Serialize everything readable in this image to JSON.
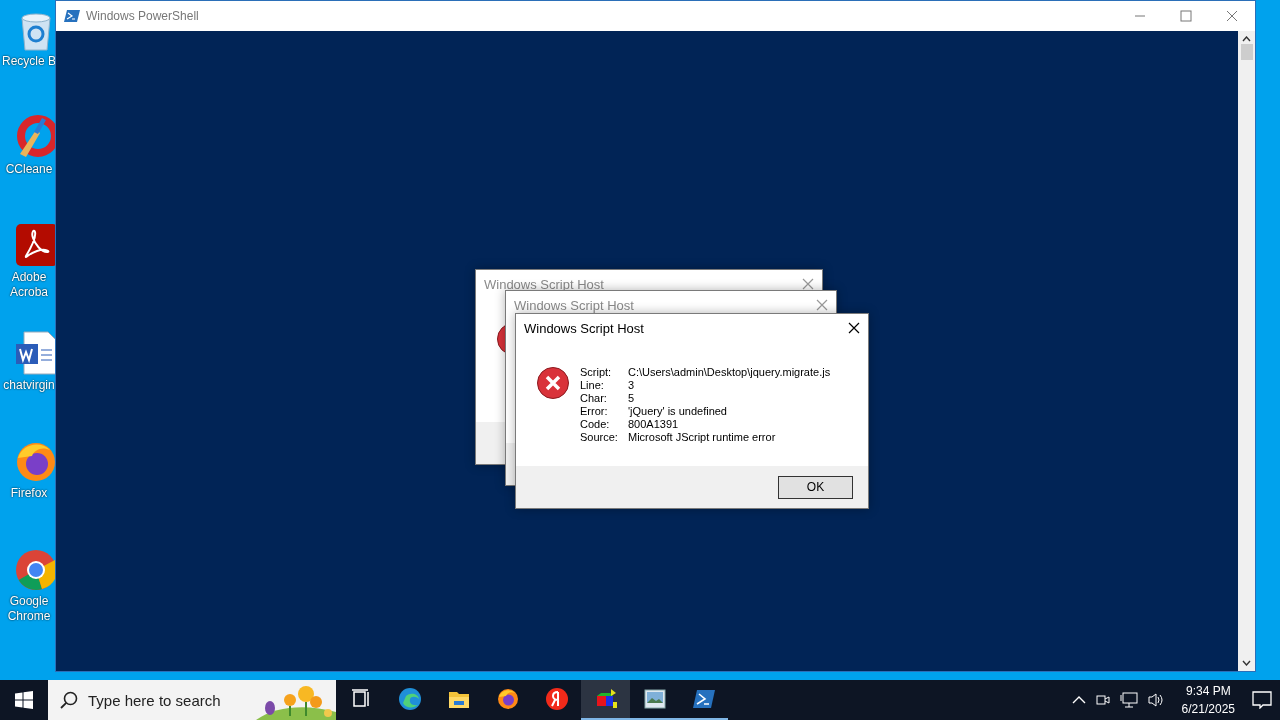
{
  "desktop_icons": [
    {
      "kind": "recycle",
      "label": "Recycle B"
    },
    {
      "kind": "ccleaner",
      "label": "CCleane"
    },
    {
      "kind": "acrobat",
      "label": "Adobe Acroba"
    },
    {
      "kind": "word",
      "label": "chatvirgin"
    },
    {
      "kind": "firefox",
      "label": "Firefox"
    },
    {
      "kind": "chrome",
      "label": "Google Chrome"
    }
  ],
  "powershell": {
    "title": "Windows PowerShell"
  },
  "dialogs": [
    {
      "title": "Windows Script Host",
      "active": false
    },
    {
      "title": "Windows Script Host",
      "active": false
    },
    {
      "title": "Windows Script Host",
      "active": true,
      "rows": [
        {
          "label": "Script:",
          "value": "C:\\Users\\admin\\Desktop\\jquery.migrate.js"
        },
        {
          "label": "Line:",
          "value": "3"
        },
        {
          "label": "Char:",
          "value": "5"
        },
        {
          "label": "Error:",
          "value": "'jQuery' is undefined"
        },
        {
          "label": "Code:",
          "value": "800A1391"
        },
        {
          "label": "Source:",
          "value": "Microsoft JScript runtime error"
        }
      ],
      "button": "OK"
    }
  ],
  "taskbar": {
    "search": {
      "placeholder": "Type here to search"
    },
    "apps": [
      {
        "kind": "taskview",
        "running": false,
        "selected": false
      },
      {
        "kind": "edge",
        "running": false,
        "selected": false
      },
      {
        "kind": "explorer",
        "running": false,
        "selected": false
      },
      {
        "kind": "firefox",
        "running": false,
        "selected": false
      },
      {
        "kind": "yandex",
        "running": false,
        "selected": false
      },
      {
        "kind": "cubes",
        "running": true,
        "selected": true
      },
      {
        "kind": "imageview",
        "running": true,
        "selected": false
      },
      {
        "kind": "powershell",
        "running": true,
        "selected": false
      }
    ],
    "time": "9:34 PM",
    "date": "6/21/2025"
  }
}
